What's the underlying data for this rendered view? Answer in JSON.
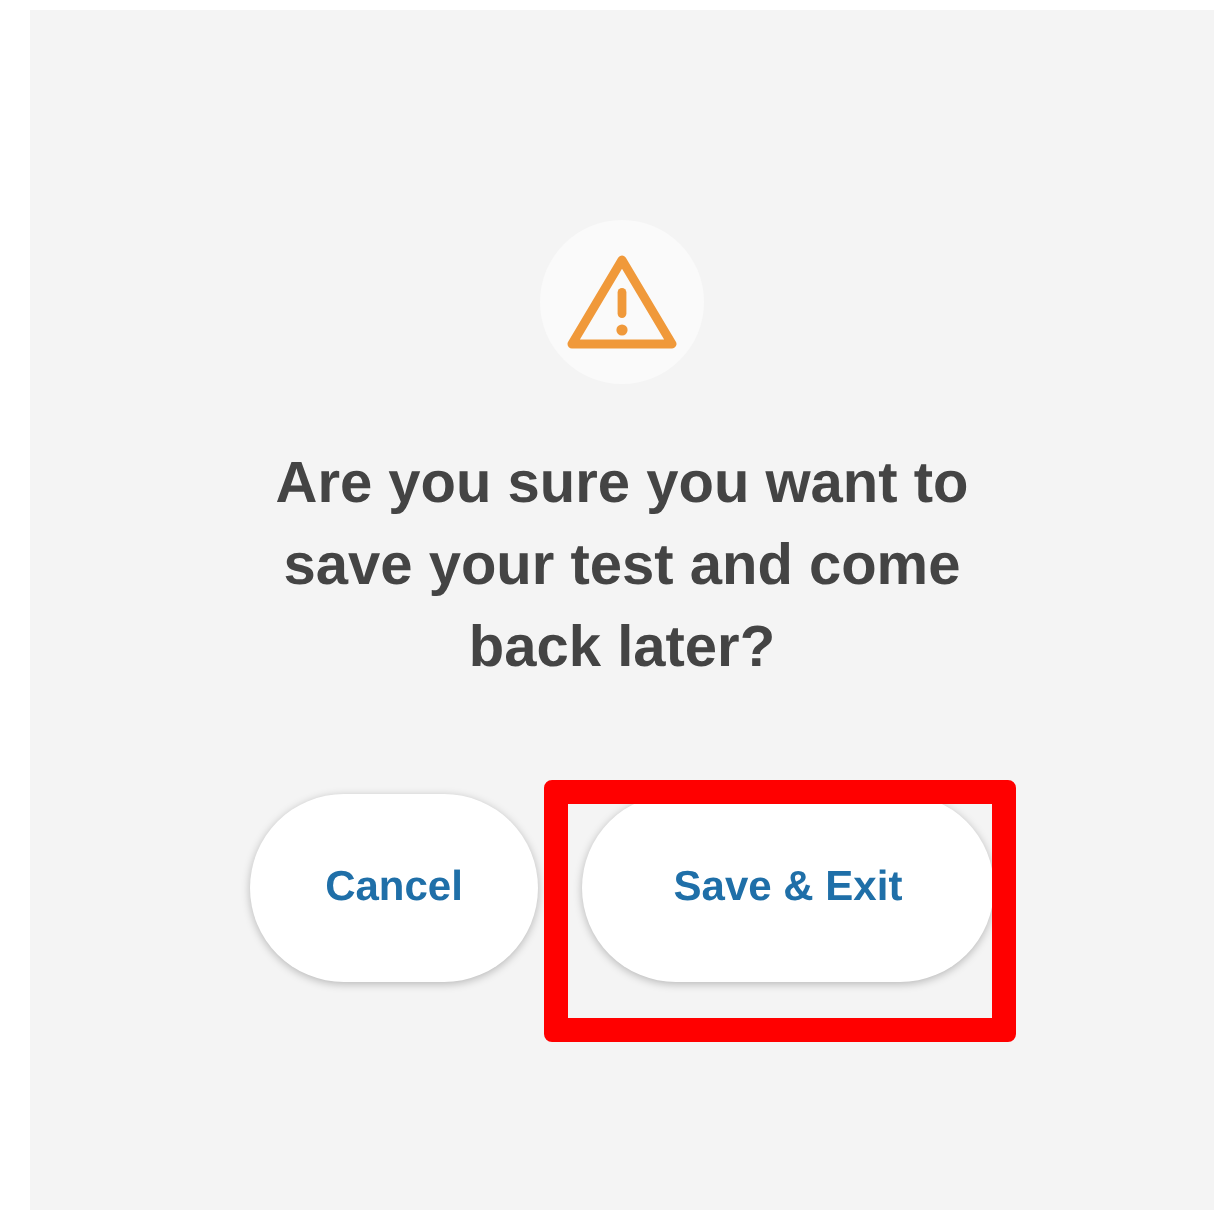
{
  "dialog": {
    "message": "Are you sure you want to save your test and come back later?",
    "buttons": [
      {
        "label": "Cancel",
        "highlighted": false
      },
      {
        "label": "Save & Exit",
        "highlighted": true
      }
    ]
  }
}
